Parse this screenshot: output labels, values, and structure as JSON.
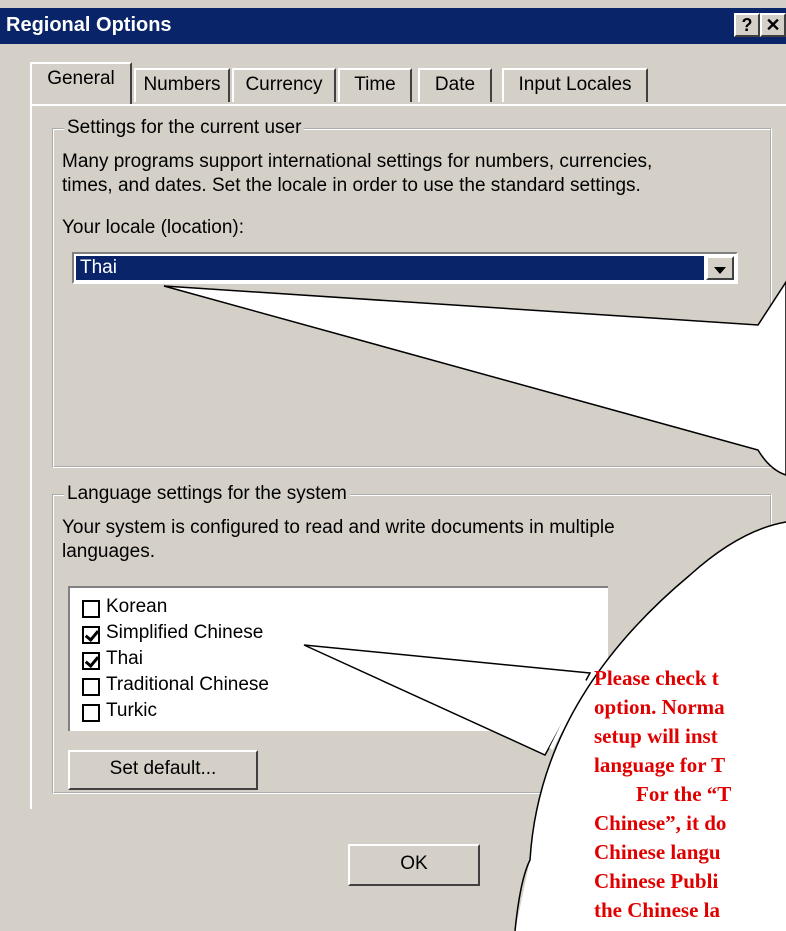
{
  "window": {
    "title": "Regional Options",
    "help_label": "?",
    "close_label": "✕"
  },
  "tabs": [
    "General",
    "Numbers",
    "Currency",
    "Time",
    "Date",
    "Input Locales"
  ],
  "user_group": {
    "legend": "Settings for the current user",
    "description_line1": "Many programs support international settings for numbers, currencies,",
    "description_line2": "times, and dates. Set the locale in order to use the standard settings.",
    "locale_label": "Your locale (location):",
    "locale_value": "Thai"
  },
  "system_group": {
    "legend": "Language settings for the system",
    "description_line1": "Your system is configured to read and write documents in multiple",
    "description_line2": "languages.",
    "languages": [
      {
        "label": "Korean",
        "checked": false
      },
      {
        "label": "Simplified Chinese",
        "checked": true
      },
      {
        "label": "Thai",
        "checked": true
      },
      {
        "label": "Traditional Chinese",
        "checked": false
      },
      {
        "label": "Turkic",
        "checked": false
      }
    ],
    "set_default_label": "Set default..."
  },
  "footer": {
    "ok_label": "OK"
  },
  "callout": {
    "lines": [
      "Please check t",
      "option. Norma",
      "setup will inst",
      "language for T",
      "For the “T",
      "Chinese”, it do",
      "Chinese langu",
      "Chinese Publi",
      "the Chinese la"
    ],
    "text_color": "#e00000"
  }
}
